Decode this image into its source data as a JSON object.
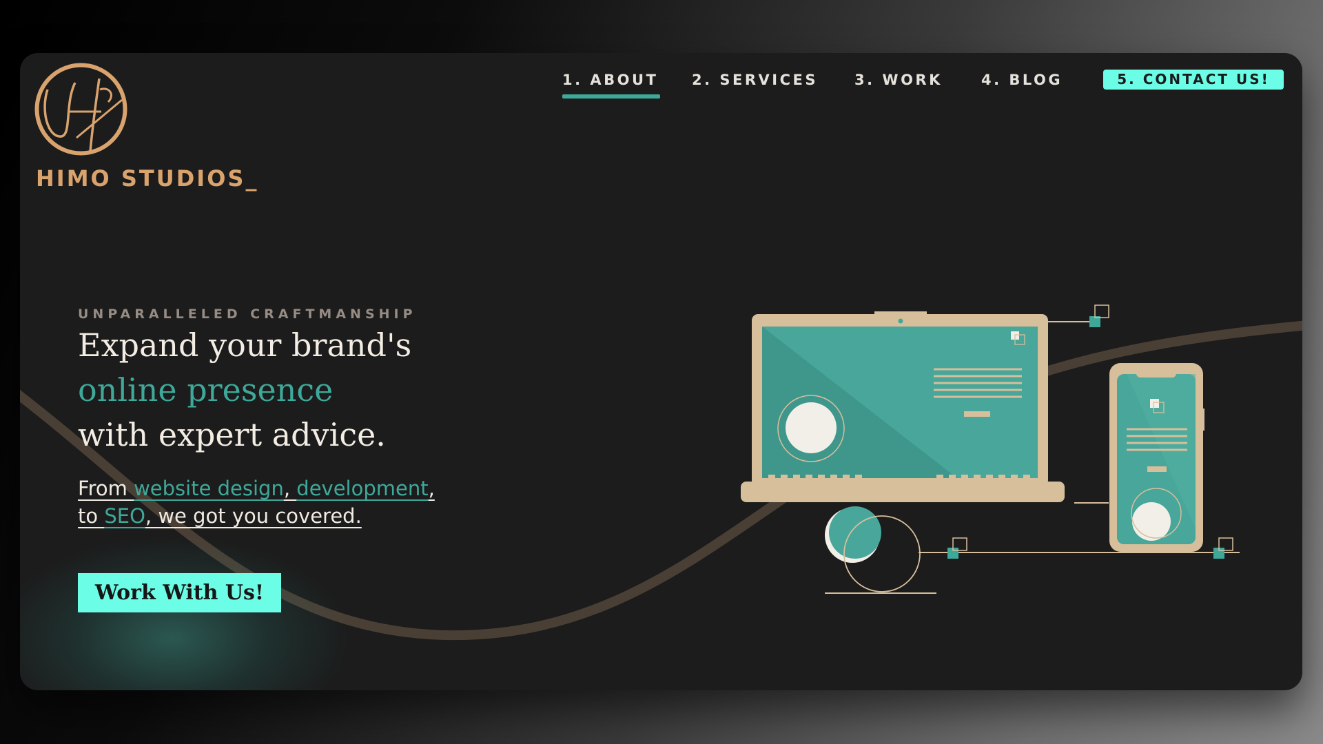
{
  "brand": {
    "name": "HIMO STUDIOS_",
    "logo_icon": "himo-monogram-logo",
    "color": "#d9a36e"
  },
  "nav": {
    "items": [
      {
        "label": "1. ABOUT",
        "active": true
      },
      {
        "label": "2. SERVICES",
        "active": false
      },
      {
        "label": "3. WORK",
        "active": false
      },
      {
        "label": "4. BLOG",
        "active": false
      }
    ],
    "contact": {
      "label": "5. CONTACT US!"
    }
  },
  "hero": {
    "eyebrow": "UNPARALLELED CRAFTMANSHIP",
    "headline_line1": "Expand your brand's",
    "headline_accent": "online presence",
    "headline_line3": "with expert advice.",
    "sub_from": "From ",
    "sub_link1": "website design",
    "sub_comma1": ", ",
    "sub_link2": "development",
    "sub_comma2": ",",
    "sub_to": "to ",
    "sub_link3": "SEO",
    "sub_tail": ", we got you covered.",
    "cta_label": "Work With Us!"
  },
  "theme": {
    "background": "#1c1c1c",
    "accent_teal": "#3ea99a",
    "accent_mint": "#6cfde6",
    "tan": "#d8bf9c"
  },
  "illustration": {
    "icon": "laptop-and-phone-illustration"
  }
}
